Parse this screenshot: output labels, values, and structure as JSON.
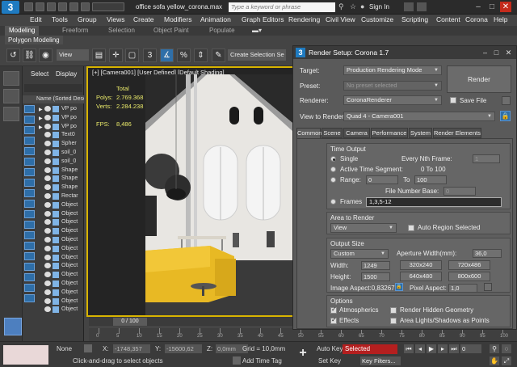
{
  "window": {
    "logo_text": "3",
    "title": "office sofa yellow_corona.max",
    "search_placeholder": "Type a keyword or phrase",
    "sign_in": "Sign In"
  },
  "menu": [
    "Edit",
    "Tools",
    "Group",
    "Views",
    "Create",
    "Modifiers",
    "Animation",
    "Graph Editors",
    "Rendering",
    "Civil View",
    "Customize",
    "Scripting",
    "Content",
    "Corona",
    "Help"
  ],
  "ribbon": {
    "tabs": [
      "Modeling",
      "Freeform",
      "Selection",
      "Object Paint",
      "Populate"
    ],
    "sub": "Polygon Modeling"
  },
  "toolbar": {
    "reference_coord": "View",
    "selection_set": "Create Selection Se"
  },
  "explorer": {
    "tabs": [
      "Select",
      "Display"
    ],
    "header": "Name (Sorted Desce",
    "rows": [
      "VP po",
      "VP po",
      "VP po",
      "Text0",
      "Spher",
      "soil_0",
      "soil_0",
      "Shape",
      "Shape",
      "Shape",
      "Rectar",
      "Object",
      "Object",
      "Object",
      "Object",
      "Object",
      "Object",
      "Object",
      "Object",
      "Object",
      "Object",
      "Object",
      "Object",
      "Object"
    ]
  },
  "viewport": {
    "label": "[+] [Camera001] [User Defined] [Default Shading]",
    "stats": {
      "total_label": "Total",
      "polys_label": "Polys:",
      "polys": "2.769.368",
      "verts_label": "Verts:",
      "verts": "2.284.238",
      "fps_label": "FPS:",
      "fps": "8,486"
    }
  },
  "timeline": {
    "frame": "0 / 100",
    "ticks": [
      "0",
      "5",
      "10",
      "15",
      "20",
      "25",
      "30",
      "35",
      "40",
      "45",
      "50",
      "55",
      "60",
      "65",
      "70",
      "75",
      "80",
      "85",
      "90",
      "95",
      "100"
    ]
  },
  "status": {
    "selection": "None",
    "prompt": "Click-and-drag to select objects",
    "x_label": "X:",
    "x_value": "-1748,357",
    "y_label": "Y:",
    "y_value": "-15600,62",
    "z_label": "Z:",
    "z_value": "0,0mm",
    "grid": "Grid = 10,0mm",
    "add_time_tag": "Add Time Tag",
    "auto_key": "Auto Key",
    "set_key": "Set Key",
    "selected": "Selected",
    "key_filters": "Key Filters...",
    "frame_num": "0"
  },
  "render_setup": {
    "title": "Render Setup: Corona 1.7",
    "target_label": "Target:",
    "target_value": "Production Rendering Mode",
    "preset_label": "Preset:",
    "preset_value": "No preset selected",
    "renderer_label": "Renderer:",
    "renderer_value": "CoronaRenderer",
    "save_file": "Save File",
    "render_button": "Render",
    "view_label": "View to Render:",
    "view_value": "Quad 4 - Camera001",
    "tabs": [
      "Common",
      "Scene",
      "Camera",
      "Performance",
      "System",
      "Render Elements"
    ],
    "time_output": {
      "title": "Time Output",
      "single": "Single",
      "every_nth": "Every Nth Frame:",
      "every_nth_value": "1",
      "active_segment": "Active Time Segment:",
      "active_range": "0 To 100",
      "range": "Range:",
      "range_from": "0",
      "to": "To",
      "range_to": "100",
      "file_number_base": "File Number Base:",
      "file_number_value": "0",
      "frames": "Frames",
      "frames_value": "1,3,5-12"
    },
    "area_to_render": {
      "title": "Area to Render",
      "value": "View",
      "auto_region": "Auto Region Selected"
    },
    "output_size": {
      "title": "Output Size",
      "preset": "Custom",
      "aperture_label": "Aperture Width(mm):",
      "aperture_value": "36,0",
      "width_label": "Width:",
      "width_value": "1249",
      "height_label": "Height:",
      "height_value": "1500",
      "presets": [
        "320x240",
        "720x486",
        "640x480",
        "800x600"
      ],
      "image_aspect": "Image Aspect:0,83267",
      "pixel_aspect_label": "Pixel Aspect:",
      "pixel_aspect_value": "1,0"
    },
    "options": {
      "title": "Options",
      "atmospherics": "Atmospherics",
      "render_hidden": "Render Hidden Geometry",
      "effects": "Effects",
      "area_lights": "Area Lights/Shadows as Points"
    }
  }
}
